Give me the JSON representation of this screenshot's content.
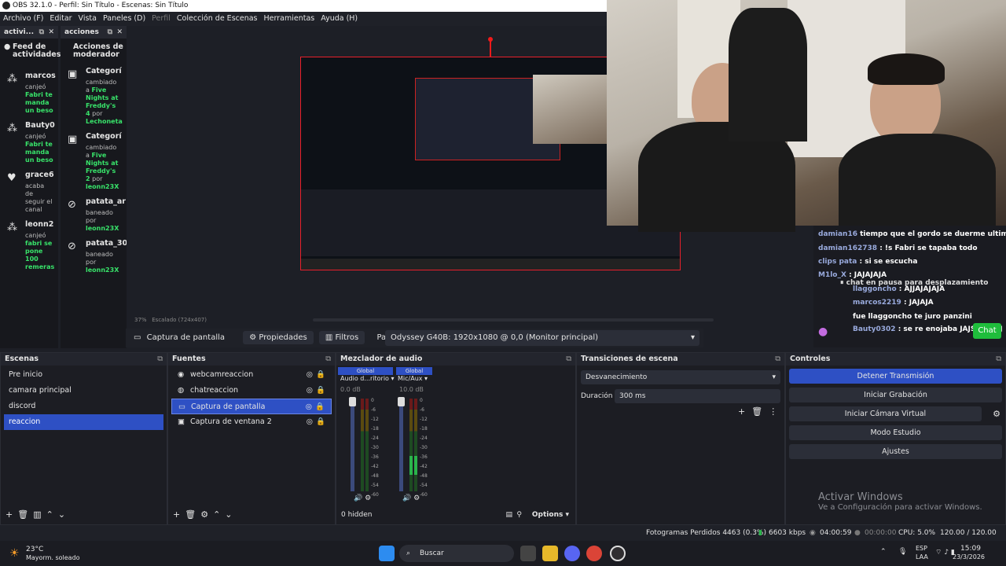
{
  "window": {
    "title": "OBS 32.1.0 - Perfil: Sin Título - Escenas: Sin Título"
  },
  "menu": [
    "Archivo (F)",
    "Editar",
    "Vista",
    "Paneles (D)",
    "Perfil",
    "Colección de Escenas",
    "Herramientas",
    "Ayuda (H)"
  ],
  "dock_activity": {
    "tab": "activi...",
    "title": "Feed de actividades",
    "items": [
      {
        "icon": "people-icon",
        "name": "marcos",
        "desc_pre": "canjeó",
        "desc_hi": "Fabri te manda un beso"
      },
      {
        "icon": "people-icon",
        "name": "Bauty0",
        "desc_pre": "canjeó",
        "desc_hi": "Fabri te manda un beso"
      },
      {
        "icon": "heart-icon",
        "name": "grace6",
        "desc_pre": "acaba de seguir el canal",
        "desc_hi": ""
      },
      {
        "icon": "people-icon",
        "name": "leonn2",
        "desc_pre": "canjeó",
        "desc_hi": "fabri se pone 100 remeras"
      }
    ]
  },
  "dock_mod": {
    "tab": "acciones",
    "title": "Acciones de moderador",
    "items": [
      {
        "icon": "category-icon",
        "name": "Categorí",
        "desc_pre": "cambiado a",
        "desc_hi": "Five Nights at Freddy's 4",
        "by": "por",
        "user": "Lechoneta"
      },
      {
        "icon": "category-icon",
        "name": "Categorí",
        "desc_pre": "cambiado a",
        "desc_hi": "Five Nights at Freddy's 2",
        "by": "por",
        "user": "leonn23X"
      },
      {
        "icon": "ban-icon",
        "name": "patata_ar",
        "desc_pre": "baneado",
        "desc_hi": "",
        "by": "por",
        "user": "leonn23X"
      },
      {
        "icon": "ban-icon",
        "name": "patata_30",
        "desc_pre": "baneado",
        "desc_hi": "",
        "by": "por",
        "user": "leonn23X"
      }
    ]
  },
  "preview": {
    "zoom": "37%",
    "scale": "Escalado (724x407)"
  },
  "source_toolbar": {
    "source": "Captura de pantalla",
    "props": "Propiedades",
    "filters": "Filtros",
    "screen_label": "Pantalla",
    "screen_value": "Odyssey G40B: 1920x1080 @ 0,0 (Monitor principal)"
  },
  "chat": {
    "lines": [
      {
        "user": "damian16",
        "msg": "tiempo que el gordo se duerme ultimo"
      },
      {
        "user": "damian162738",
        "msg": ": !s Fabri se tapaba todo"
      },
      {
        "user": "clips pata",
        "msg": ": si se escucha"
      },
      {
        "user": "M1lo_X",
        "msg": ": JAJAJAJA"
      },
      {
        "user": "",
        "msg": "chat en pausa para desplazamiento"
      },
      {
        "user": "llaggoncho",
        "msg": ": AJJAJAJAJA"
      },
      {
        "user": "marcos2219",
        "msg": ": JAJAJA"
      },
      {
        "user": "",
        "msg": "fue llaggoncho te juro panzini"
      },
      {
        "user": "Bauty0302",
        "msg": ": se re enojaba JAJSJAJAJAJ"
      }
    ],
    "button": "Chat"
  },
  "scenes": {
    "title": "Escenas",
    "items": [
      "Pre inicio",
      "camara principal",
      "discord",
      "reaccion"
    ],
    "selected": 3
  },
  "sources": {
    "title": "Fuentes",
    "items": [
      {
        "icon": "camera-icon",
        "label": "webcamreaccion"
      },
      {
        "icon": "globe-icon",
        "label": "chatreaccion"
      },
      {
        "icon": "monitor-icon",
        "label": "Captura de pantalla"
      },
      {
        "icon": "window-icon",
        "label": "Captura de ventana 2"
      }
    ],
    "selected": 2
  },
  "mixer": {
    "title": "Mezclador de audio",
    "channels": [
      {
        "tag": "Global",
        "name": "Audio d...ritorio",
        "db": "0.0 dB"
      },
      {
        "tag": "Global",
        "name": "Mic/Aux",
        "db": "10.0 dB"
      }
    ],
    "scale": [
      "0",
      "-6",
      "-12",
      "-18",
      "-24",
      "-30",
      "-36",
      "-42",
      "-48",
      "-54",
      "-60"
    ],
    "hidden": "0 hidden",
    "options": "Options"
  },
  "transitions": {
    "title": "Transiciones de escena",
    "type": "Desvanecimiento",
    "duration_label": "Duración",
    "duration": "300 ms"
  },
  "controls": {
    "title": "Controles",
    "buttons": [
      "Detener Transmisión",
      "Iniciar Grabación",
      "Iniciar Cámara Virtual",
      "Modo Estudio",
      "Ajustes"
    ]
  },
  "status": {
    "dropped": "Fotogramas Perdidos 4463 (0.3%)",
    "bitrate": "6603 kbps",
    "stream_time": "04:00:59",
    "rec_time": "00:00:00",
    "cpu": "CPU: 5.0%",
    "fps": "120.00 / 120.00 FPS"
  },
  "watermark": {
    "title": "Activar Windows",
    "sub": "Ve a Configuración para activar Windows."
  },
  "taskbar": {
    "weather_temp": "23°C",
    "weather_desc": "Mayorm. soleado",
    "search": "Buscar",
    "lang1": "ESP",
    "lang2": "LAA",
    "time": "15:09",
    "date": "23/3/2026"
  }
}
